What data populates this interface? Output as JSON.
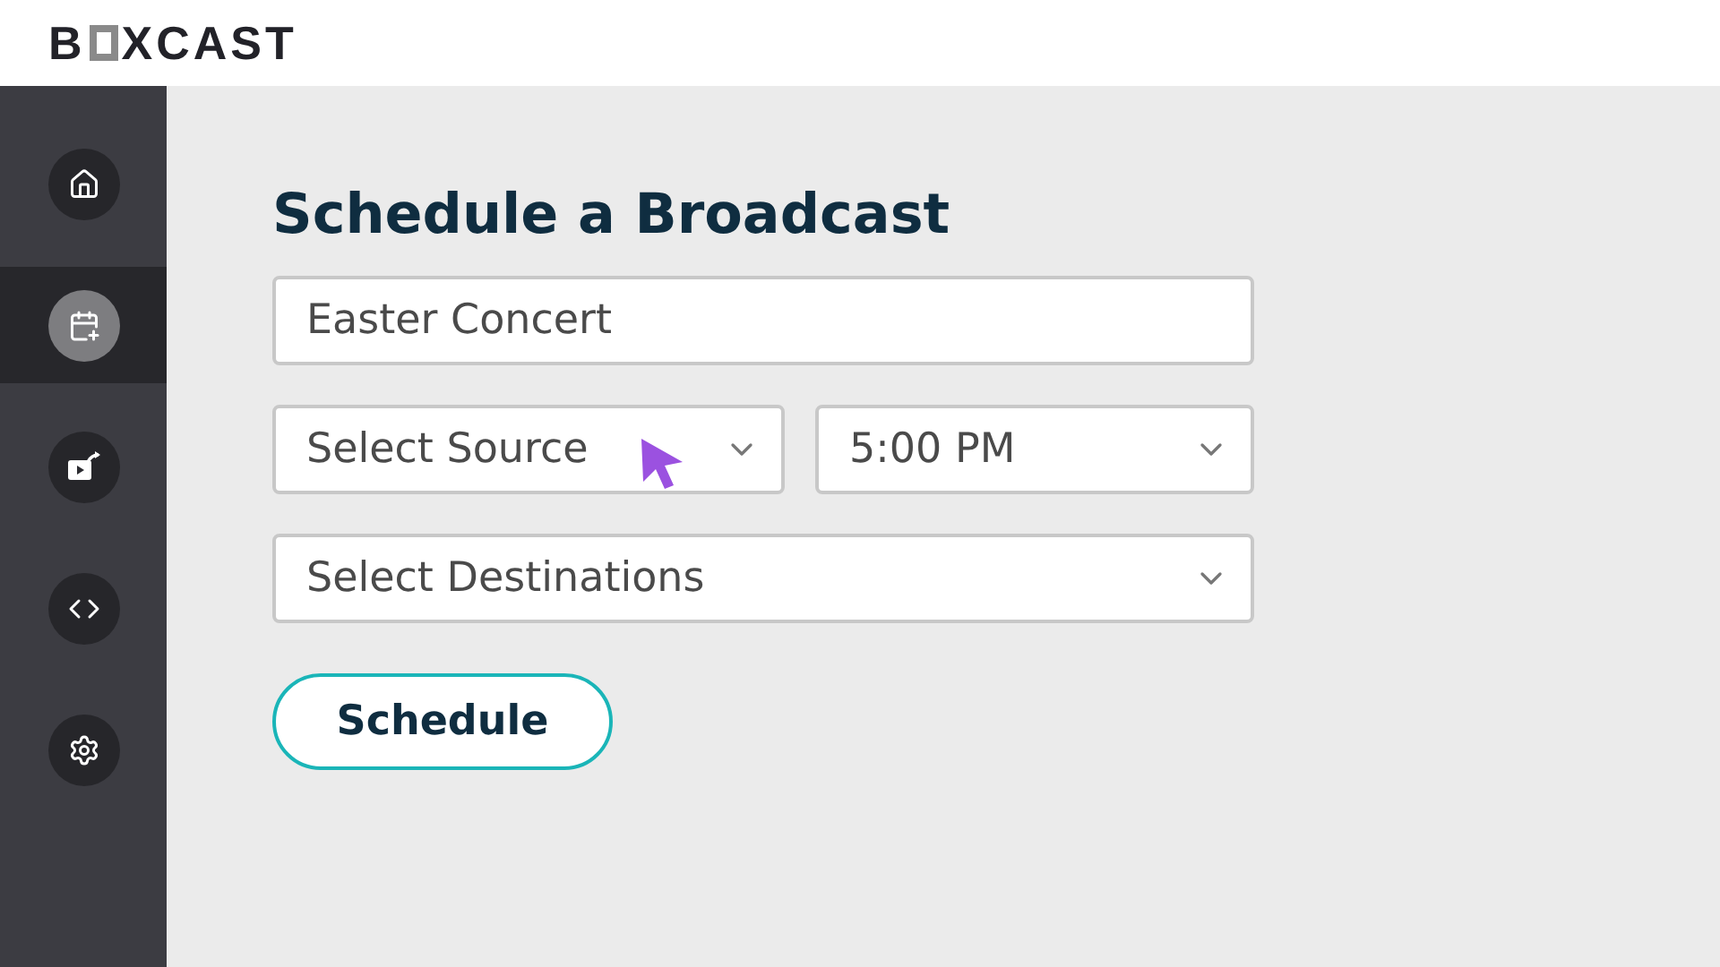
{
  "logo": {
    "before": "B",
    "after": "XCAST"
  },
  "sidebar": {
    "items": [
      {
        "kind": "home",
        "selected": false
      },
      {
        "kind": "calendar",
        "selected": true
      },
      {
        "kind": "video",
        "selected": false
      },
      {
        "kind": "code",
        "selected": false
      },
      {
        "kind": "settings",
        "selected": false
      }
    ]
  },
  "title": "Schedule a Broadcast",
  "name_field": {
    "value": "Easter Concert"
  },
  "source_select": {
    "value": "Select Source"
  },
  "time_select": {
    "value": "5:00 PM"
  },
  "destinations_select": {
    "value": "Select Destinations"
  },
  "schedule_button": "Schedule"
}
